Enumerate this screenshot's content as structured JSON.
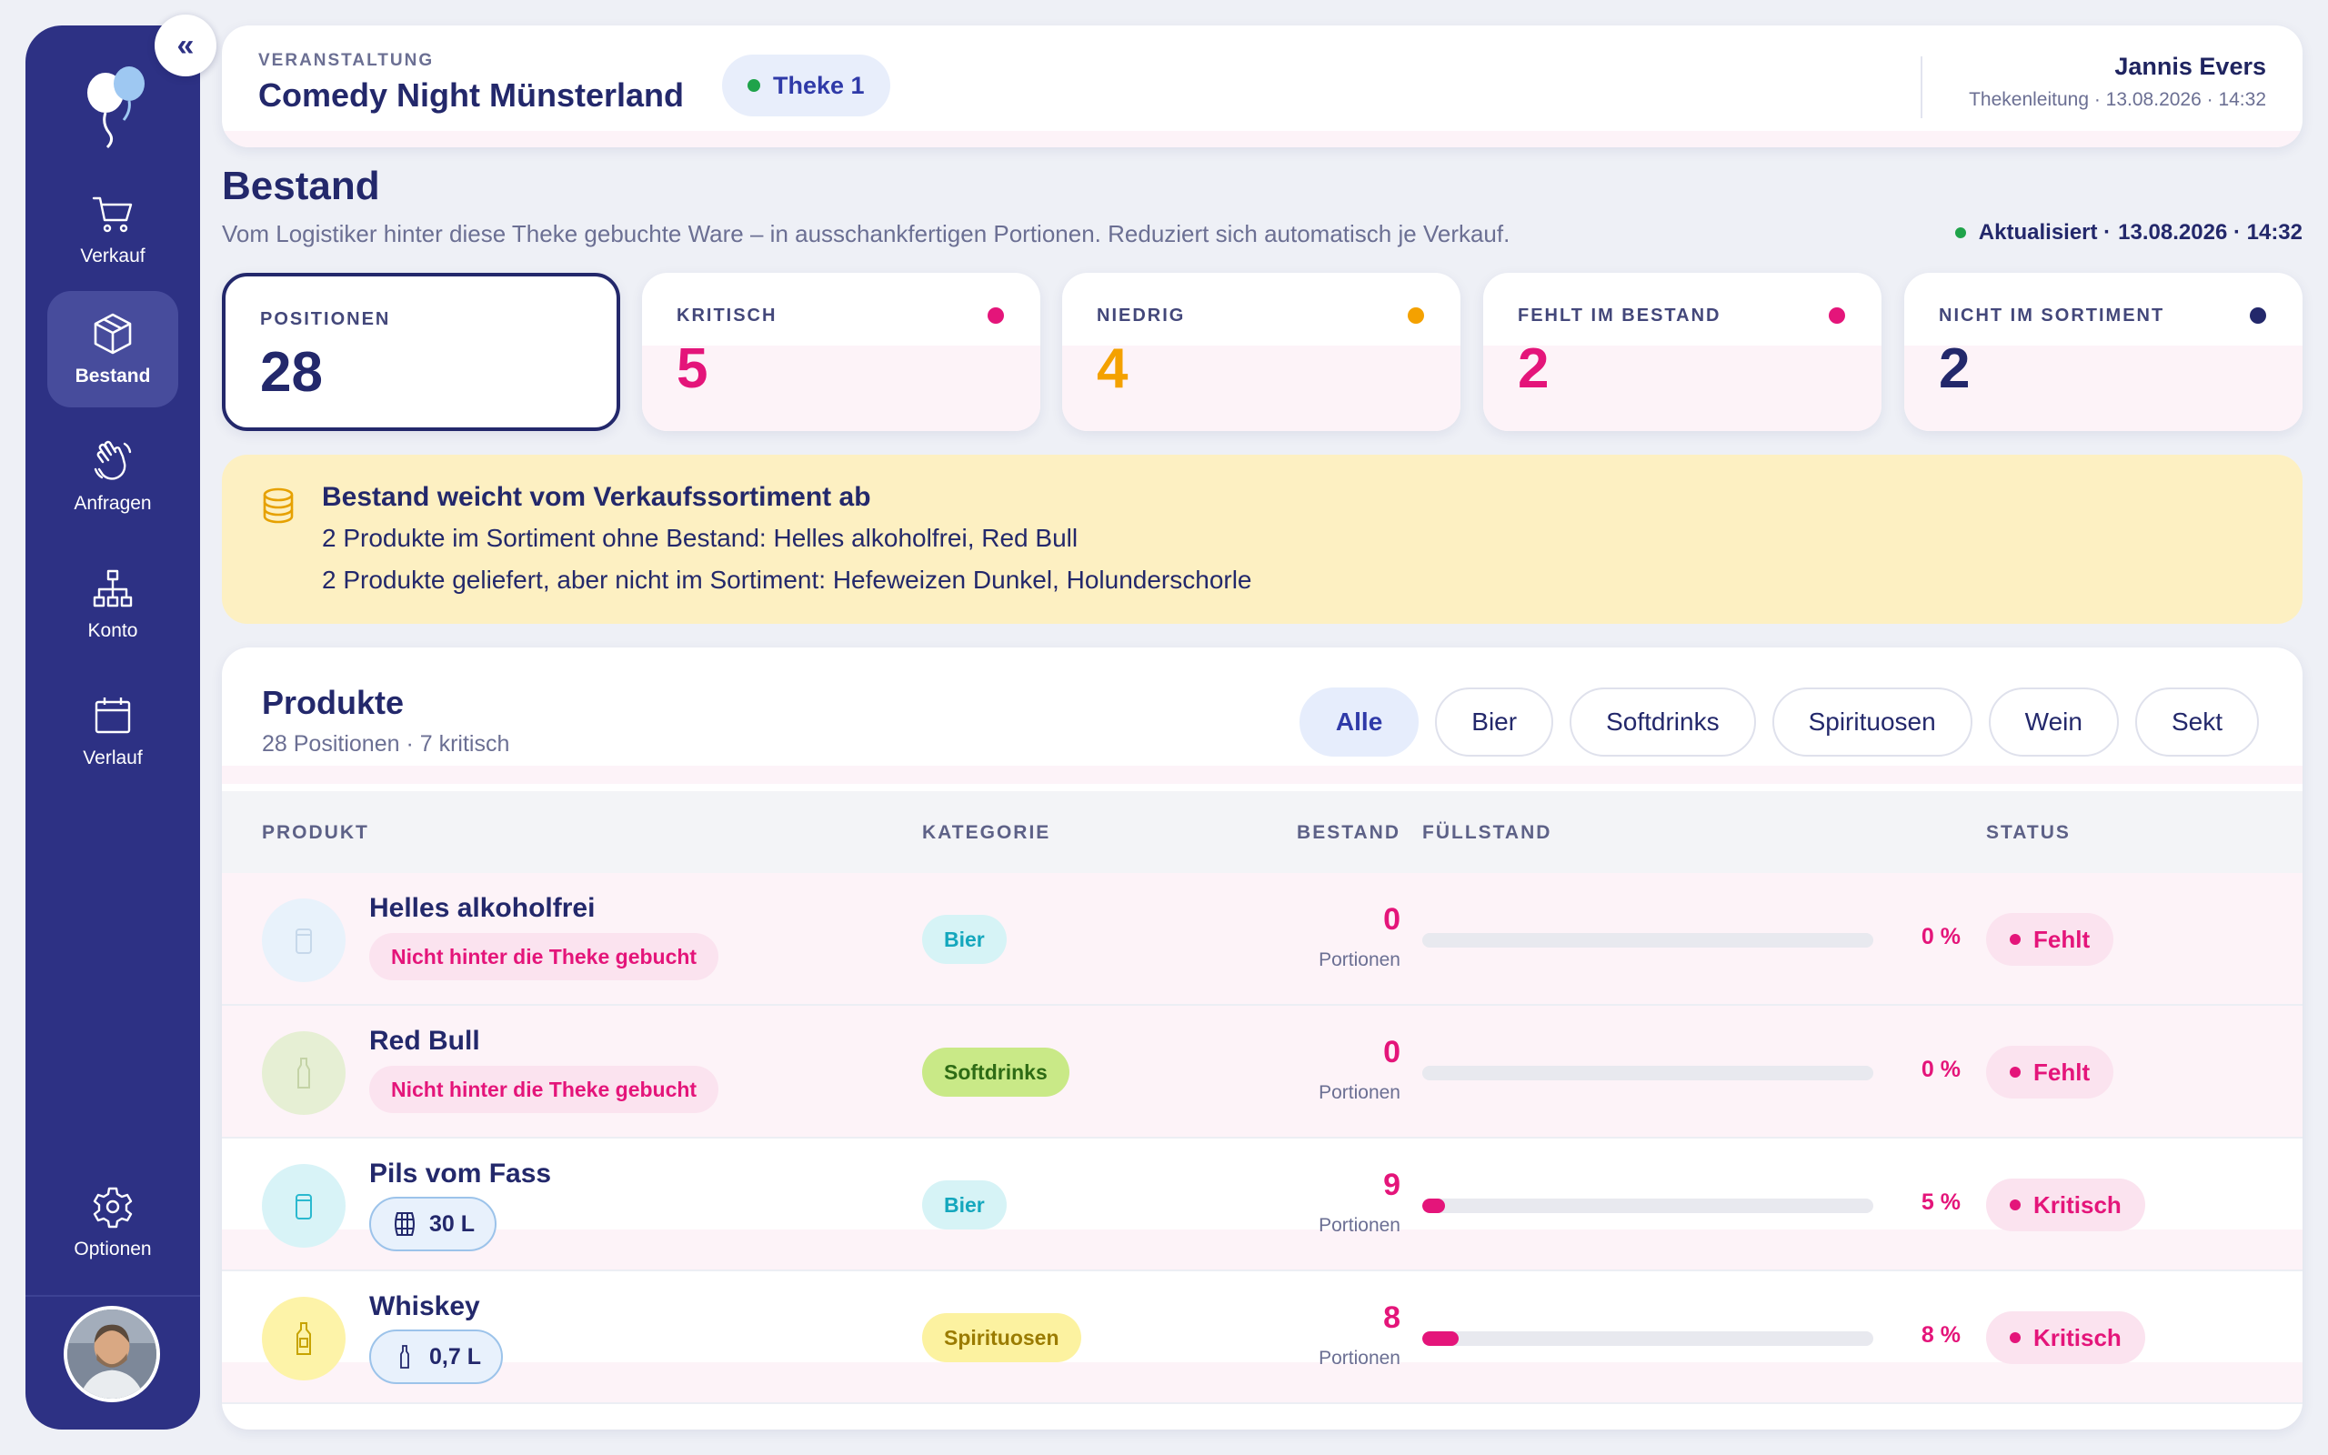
{
  "sidebar": {
    "collapse_label": "«",
    "items": [
      {
        "label": "Verkauf",
        "icon": "cart-icon",
        "active": false
      },
      {
        "label": "Bestand",
        "icon": "box-icon",
        "active": true
      },
      {
        "label": "Anfragen",
        "icon": "hand-wave-icon",
        "active": false
      },
      {
        "label": "Konto",
        "icon": "network-icon",
        "active": false
      },
      {
        "label": "Verlauf",
        "icon": "calendar-icon",
        "active": false
      },
      {
        "label": "Optionen",
        "icon": "gear-icon",
        "active": false
      }
    ]
  },
  "header": {
    "kicker": "VERANSTALTUNG",
    "event_title": "Comedy Night Münsterland",
    "counter_label": "Theke 1",
    "user_name": "Jannis Evers",
    "user_meta": "Thekenleitung · 13.08.2026 · 14:32"
  },
  "page": {
    "title": "Bestand",
    "subtitle": "Vom Logistiker hinter diese Theke gebuchte Ware – in ausschankfertigen Portionen. Reduziert sich automatisch je Verkauf.",
    "updated_label": "Aktualisiert ·",
    "updated_time": "13.08.2026 · 14:32"
  },
  "stats": [
    {
      "label": "POSITIONEN",
      "value": "28",
      "color": "#23286b",
      "dot": null
    },
    {
      "label": "KRITISCH",
      "value": "5",
      "color": "#e4157a",
      "dot": "#e4157a"
    },
    {
      "label": "NIEDRIG",
      "value": "4",
      "color": "#f4a100",
      "dot": "#f4a100"
    },
    {
      "label": "FEHLT IM BESTAND",
      "value": "2",
      "color": "#e4157a",
      "dot": "#e4157a"
    },
    {
      "label": "NICHT IM SORTIMENT",
      "value": "2",
      "color": "#23286b",
      "dot": "#23286b"
    }
  ],
  "alert": {
    "icon": "coins-icon",
    "title": "Bestand weicht vom Verkaufssortiment ab",
    "line1": "2 Produkte im Sortiment ohne Bestand: Helles alkoholfrei, Red Bull",
    "line2": "2 Produkte geliefert, aber nicht im Sortiment: Hefeweizen Dunkel, Holunderschorle"
  },
  "products": {
    "title": "Produkte",
    "subtitle": "28 Positionen · 7 kritisch",
    "filters": [
      {
        "label": "Alle",
        "active": true
      },
      {
        "label": "Bier",
        "active": false
      },
      {
        "label": "Softdrinks",
        "active": false
      },
      {
        "label": "Spirituosen",
        "active": false
      },
      {
        "label": "Wein",
        "active": false
      },
      {
        "label": "Sekt",
        "active": false
      }
    ],
    "columns": {
      "product": "PRODUKT",
      "category": "KATEGORIE",
      "stock": "BESTAND",
      "fill": "FÜLLSTAND",
      "status": "STATUS"
    },
    "rows": [
      {
        "name": "Helles alkoholfrei",
        "note": "Nicht hinter die Theke gebucht",
        "size": null,
        "category": "Bier",
        "stock": "0",
        "unit": "Portionen",
        "fill": 0,
        "pct": "0 %",
        "status": "Fehlt",
        "thumb_icon": "glass-icon"
      },
      {
        "name": "Red Bull",
        "note": "Nicht hinter die Theke gebucht",
        "size": null,
        "category": "Softdrinks",
        "stock": "0",
        "unit": "Portionen",
        "fill": 0,
        "pct": "0 %",
        "status": "Fehlt",
        "thumb_icon": "bottle-icon"
      },
      {
        "name": "Pils vom Fass",
        "note": null,
        "size": "30 L",
        "size_icon": "barrel-icon",
        "category": "Bier",
        "stock": "9",
        "unit": "Portionen",
        "fill": 0.05,
        "pct": "5 %",
        "status": "Kritisch",
        "thumb_icon": "glass-icon"
      },
      {
        "name": "Whiskey",
        "note": null,
        "size": "0,7 L",
        "size_icon": "bottle-icon",
        "category": "Spirituosen",
        "stock": "8",
        "unit": "Portionen",
        "fill": 0.08,
        "pct": "8 %",
        "status": "Kritisch",
        "thumb_icon": "whiskey-bottle-icon"
      }
    ]
  },
  "colors": {
    "sidebar": "#2d3184",
    "accent": "#23286b",
    "critical": "#e4157a",
    "low": "#f4a100",
    "online": "#1fa34a"
  }
}
